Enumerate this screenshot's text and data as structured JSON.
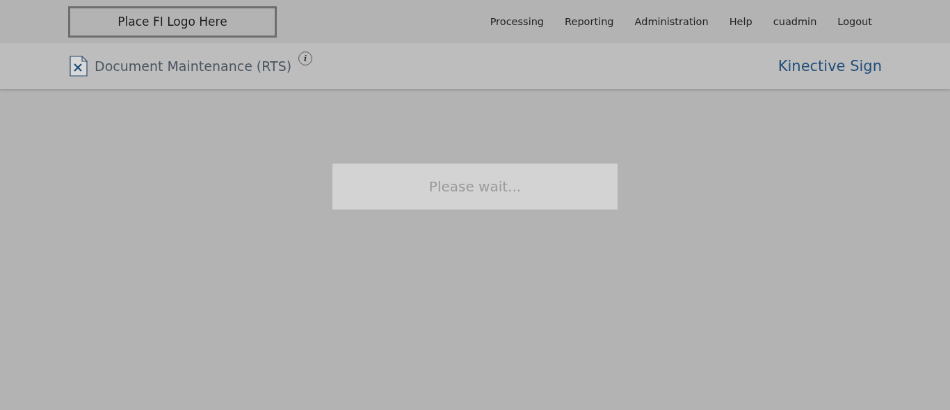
{
  "header": {
    "logo": "Place FI Logo Here",
    "nav": [
      "Processing",
      "Reporting",
      "Administration",
      "Help",
      "cuadmin",
      "Logout"
    ]
  },
  "subheader": {
    "title": "Document Maintenance (RTS)",
    "info": "i",
    "brand": "Kinective Sign"
  },
  "loading": {
    "message": "Please wait..."
  }
}
